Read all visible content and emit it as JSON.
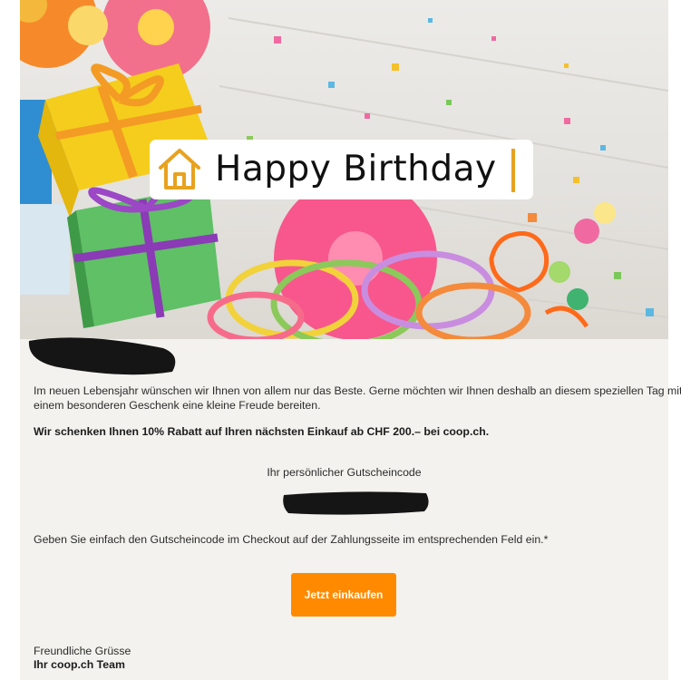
{
  "hero": {
    "banner_text": "Happy Birthday"
  },
  "body": {
    "intro": "Im neuen Lebensjahr wünschen wir Ihnen von allem nur das Beste. Gerne möchten wir Ihnen deshalb an diesem speziellen Tag mit",
    "intro_line2": "einem besonderen Geschenk eine kleine Freude bereiten.",
    "offer": "Wir schenken Ihnen 10% Rabatt auf Ihren nächsten Einkauf ab CHF 200.– bei coop.ch.",
    "voucher_label": "Ihr persönlicher Gutscheincode",
    "instructions": "Geben Sie einfach den Gutscheincode im Checkout auf der Zahlungsseite im entsprechenden Feld ein.*",
    "cta_label": "Jetzt einkaufen",
    "closing": "Freundliche Grüsse",
    "signature": "Ihr coop.ch Team"
  },
  "colors": {
    "accent": "#ff8a00",
    "house_icon": "#e8a21f",
    "background": "#f3f2ee"
  },
  "icons": [
    "house-icon"
  ]
}
